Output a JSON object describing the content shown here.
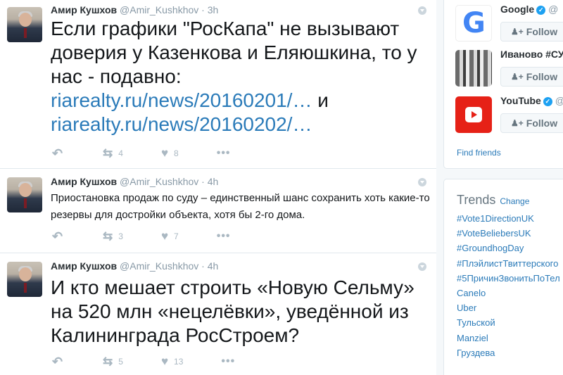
{
  "tweets": [
    {
      "name": "Амир Кушхов",
      "handle": "@Amir_Kushkhov",
      "time": "3h",
      "text_before": "Если графики \"РосКапа\" не вызывают доверия у Казенкова и Еляюшкина, то у нас - подавно: ",
      "link1": "riarealty.ru/news/20160201/…",
      "mid": " и ",
      "link2": "riarealty.ru/news/20160202/…",
      "retweets": "4",
      "likes": "8"
    },
    {
      "name": "Амир Кушхов",
      "handle": "@Amir_Kushkhov",
      "time": "4h",
      "text": "Приостановка продаж по суду – единственный шанс сохранить хоть какие-то резервы для достройки объекта, хотя бы 2-го дома.",
      "retweets": "3",
      "likes": "7"
    },
    {
      "name": "Амир Кушхов",
      "handle": "@Amir_Kushkhov",
      "time": "4h",
      "text": "И кто мешает строить «Новую Сельму» на 520 млн «нецелёвки», уведённой из Калининграда РосСтроем?",
      "retweets": "5",
      "likes": "13"
    }
  ],
  "who_to_follow": {
    "accounts": [
      {
        "name": "Google",
        "handle": "@",
        "follow_label": "Follow",
        "verified": true
      },
      {
        "name": "Иваново #СУ",
        "handle": "",
        "follow_label": "Follow",
        "verified": false
      },
      {
        "name": "YouTube",
        "handle": "@",
        "follow_label": "Follow",
        "verified": true
      }
    ],
    "find_friends": "Find friends"
  },
  "trends": {
    "title": "Trends",
    "change": "Change",
    "items": [
      "#Vote1DirectionUK",
      "#VoteBeliebersUK",
      "#GroundhogDay",
      "#ПлэйлистТвиттерского",
      "#5ПричинЗвонитьПоТел",
      "Canelo",
      "Uber",
      "Тульской",
      "Manziel",
      "Груздева"
    ]
  },
  "colors": {
    "link": "#2b7bb9",
    "muted": "#8899a6",
    "youtube": "#e62117",
    "verified": "#1da1f2"
  }
}
